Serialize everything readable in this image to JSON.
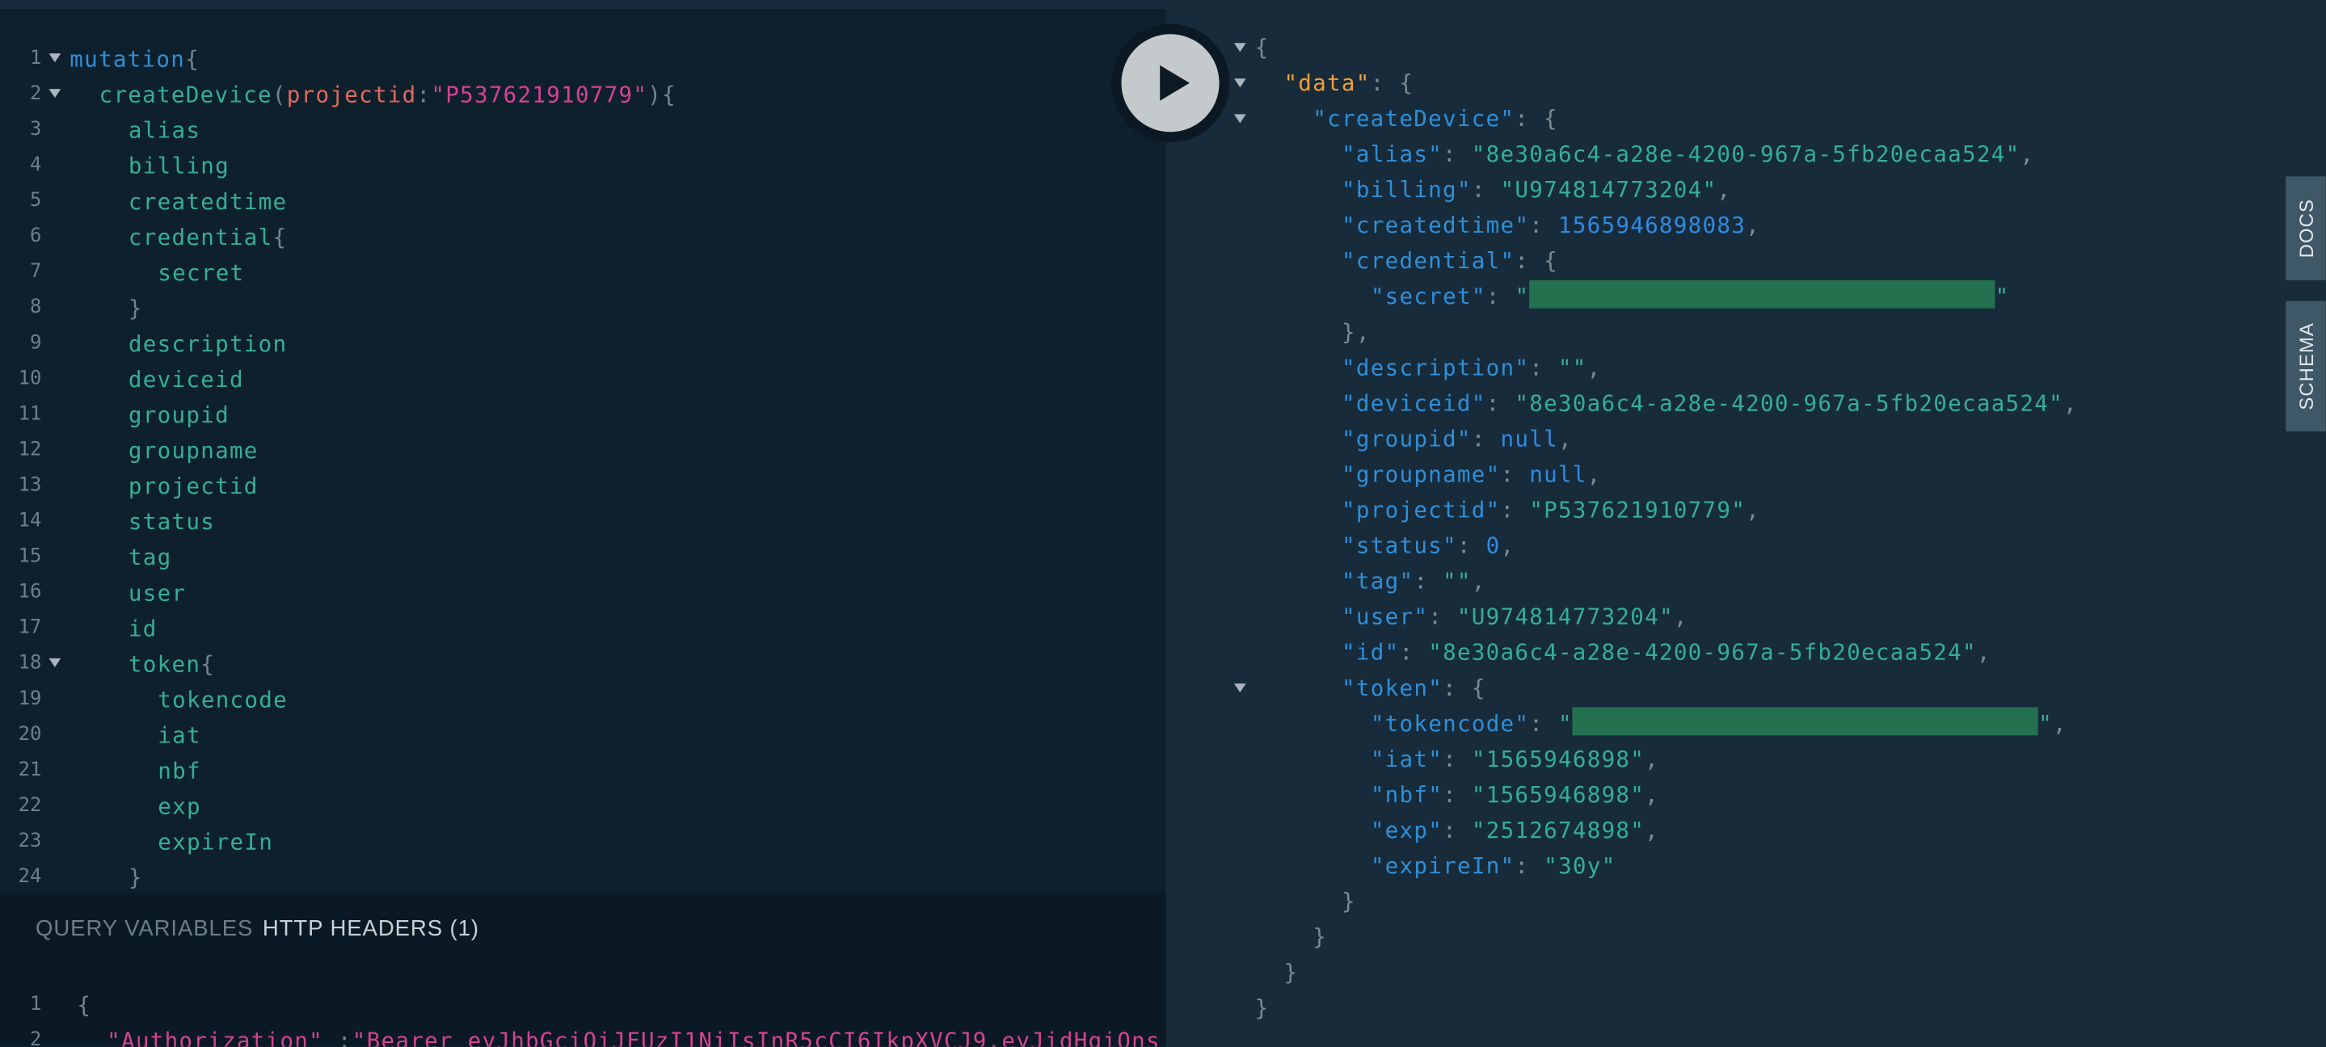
{
  "editor": {
    "lines": [
      {
        "n": "1",
        "fold": true,
        "ind": 0,
        "parts": [
          [
            "kw",
            "mutation"
          ],
          [
            "pn",
            "{"
          ]
        ]
      },
      {
        "n": "2",
        "fold": true,
        "ind": 1,
        "parts": [
          [
            "fn",
            "createDevice"
          ],
          [
            "pn",
            "("
          ],
          [
            "ar",
            "projectid"
          ],
          [
            "pn",
            ":"
          ],
          [
            "st",
            "\"P537621910779\""
          ],
          [
            "pn",
            "){"
          ]
        ]
      },
      {
        "n": "3",
        "ind": 2,
        "parts": [
          [
            "fd",
            "alias"
          ]
        ]
      },
      {
        "n": "4",
        "ind": 2,
        "parts": [
          [
            "fd",
            "billing"
          ]
        ]
      },
      {
        "n": "5",
        "ind": 2,
        "parts": [
          [
            "fd",
            "createdtime"
          ]
        ]
      },
      {
        "n": "6",
        "ind": 2,
        "parts": [
          [
            "fd",
            "credential"
          ],
          [
            "pn",
            "{"
          ]
        ]
      },
      {
        "n": "7",
        "ind": 3,
        "parts": [
          [
            "fd",
            "secret"
          ]
        ]
      },
      {
        "n": "8",
        "ind": 2,
        "parts": [
          [
            "pn",
            "}"
          ]
        ]
      },
      {
        "n": "9",
        "ind": 2,
        "parts": [
          [
            "fd",
            "description"
          ]
        ]
      },
      {
        "n": "10",
        "ind": 2,
        "parts": [
          [
            "fd",
            "deviceid"
          ]
        ]
      },
      {
        "n": "11",
        "ind": 2,
        "parts": [
          [
            "fd",
            "groupid"
          ]
        ]
      },
      {
        "n": "12",
        "ind": 2,
        "parts": [
          [
            "fd",
            "groupname"
          ]
        ]
      },
      {
        "n": "13",
        "ind": 2,
        "parts": [
          [
            "fd",
            "projectid"
          ]
        ]
      },
      {
        "n": "14",
        "ind": 2,
        "parts": [
          [
            "fd",
            "status"
          ]
        ]
      },
      {
        "n": "15",
        "ind": 2,
        "parts": [
          [
            "fd",
            "tag"
          ]
        ]
      },
      {
        "n": "16",
        "ind": 2,
        "parts": [
          [
            "fd",
            "user"
          ]
        ]
      },
      {
        "n": "17",
        "ind": 2,
        "parts": [
          [
            "fd",
            "id"
          ]
        ]
      },
      {
        "n": "18",
        "fold": true,
        "ind": 2,
        "parts": [
          [
            "fd",
            "token"
          ],
          [
            "pn",
            "{"
          ]
        ]
      },
      {
        "n": "19",
        "ind": 3,
        "parts": [
          [
            "fd",
            "tokencode"
          ]
        ]
      },
      {
        "n": "20",
        "ind": 3,
        "parts": [
          [
            "fd",
            "iat"
          ]
        ]
      },
      {
        "n": "21",
        "ind": 3,
        "parts": [
          [
            "fd",
            "nbf"
          ]
        ]
      },
      {
        "n": "22",
        "ind": 3,
        "parts": [
          [
            "fd",
            "exp"
          ]
        ]
      },
      {
        "n": "23",
        "ind": 3,
        "parts": [
          [
            "fd",
            "expireIn"
          ]
        ]
      },
      {
        "n": "24",
        "ind": 2,
        "parts": [
          [
            "pn",
            "}"
          ]
        ]
      }
    ]
  },
  "variables_panel": {
    "tab_query_variables": "QUERY VARIABLES",
    "tab_http_headers": "HTTP HEADERS (1)",
    "lines": [
      {
        "n": "1",
        "ind": 0,
        "parts": [
          [
            "pn",
            "{"
          ]
        ]
      },
      {
        "n": "2",
        "ind": 1,
        "parts": [
          [
            "vstr",
            "\"Authorization\""
          ],
          [
            "pn",
            " :"
          ],
          [
            "vstr",
            "\"Bearer eyJhbGciOiJFUzI1NiIsInR5cCI6IkpXVCJ9.eyJidHgiOns"
          ]
        ]
      }
    ]
  },
  "result": {
    "lines": [
      {
        "fold": true,
        "ind": 0,
        "parts": [
          [
            "rp",
            "{"
          ]
        ]
      },
      {
        "fold": true,
        "ind": 1,
        "parts": [
          [
            "rk-top",
            "\"data\""
          ],
          [
            "rp",
            ": {"
          ]
        ]
      },
      {
        "fold": true,
        "ind": 2,
        "parts": [
          [
            "rk",
            "\"createDevice\""
          ],
          [
            "rp",
            ": {"
          ]
        ]
      },
      {
        "ind": 3,
        "parts": [
          [
            "rk",
            "\"alias\""
          ],
          [
            "rp",
            ": "
          ],
          [
            "rs",
            "\"8e30a6c4-a28e-4200-967a-5fb20ecaa524\""
          ],
          [
            "rp",
            ","
          ]
        ]
      },
      {
        "ind": 3,
        "parts": [
          [
            "rk",
            "\"billing\""
          ],
          [
            "rp",
            ": "
          ],
          [
            "rs",
            "\"U974814773204\""
          ],
          [
            "rp",
            ","
          ]
        ]
      },
      {
        "ind": 3,
        "parts": [
          [
            "rk",
            "\"createdtime\""
          ],
          [
            "rp",
            ": "
          ],
          [
            "rn",
            "1565946898083"
          ],
          [
            "rp",
            ","
          ]
        ]
      },
      {
        "ind": 3,
        "parts": [
          [
            "rk",
            "\"credential\""
          ],
          [
            "rp",
            ": {"
          ]
        ]
      },
      {
        "ind": 4,
        "parts": [
          [
            "rk",
            "\"secret\""
          ],
          [
            "rp",
            ": "
          ],
          [
            "rs",
            "\""
          ],
          [
            "redact",
            ""
          ],
          [
            "rs",
            "\""
          ]
        ]
      },
      {
        "ind": 3,
        "parts": [
          [
            "rp",
            "},"
          ]
        ]
      },
      {
        "ind": 3,
        "parts": [
          [
            "rk",
            "\"description\""
          ],
          [
            "rp",
            ": "
          ],
          [
            "rs",
            "\"\""
          ],
          [
            "rp",
            ","
          ]
        ]
      },
      {
        "ind": 3,
        "parts": [
          [
            "rk",
            "\"deviceid\""
          ],
          [
            "rp",
            ": "
          ],
          [
            "rs",
            "\"8e30a6c4-a28e-4200-967a-5fb20ecaa524\""
          ],
          [
            "rp",
            ","
          ]
        ]
      },
      {
        "ind": 3,
        "parts": [
          [
            "rk",
            "\"groupid\""
          ],
          [
            "rp",
            ": "
          ],
          [
            "rnull",
            "null"
          ],
          [
            "rp",
            ","
          ]
        ]
      },
      {
        "ind": 3,
        "parts": [
          [
            "rk",
            "\"groupname\""
          ],
          [
            "rp",
            ": "
          ],
          [
            "rnull",
            "null"
          ],
          [
            "rp",
            ","
          ]
        ]
      },
      {
        "ind": 3,
        "parts": [
          [
            "rk",
            "\"projectid\""
          ],
          [
            "rp",
            ": "
          ],
          [
            "rs",
            "\"P537621910779\""
          ],
          [
            "rp",
            ","
          ]
        ]
      },
      {
        "ind": 3,
        "parts": [
          [
            "rk",
            "\"status\""
          ],
          [
            "rp",
            ": "
          ],
          [
            "rn",
            "0"
          ],
          [
            "rp",
            ","
          ]
        ]
      },
      {
        "ind": 3,
        "parts": [
          [
            "rk",
            "\"tag\""
          ],
          [
            "rp",
            ": "
          ],
          [
            "rs",
            "\"\""
          ],
          [
            "rp",
            ","
          ]
        ]
      },
      {
        "ind": 3,
        "parts": [
          [
            "rk",
            "\"user\""
          ],
          [
            "rp",
            ": "
          ],
          [
            "rs",
            "\"U974814773204\""
          ],
          [
            "rp",
            ","
          ]
        ]
      },
      {
        "ind": 3,
        "parts": [
          [
            "rk",
            "\"id\""
          ],
          [
            "rp",
            ": "
          ],
          [
            "rs",
            "\"8e30a6c4-a28e-4200-967a-5fb20ecaa524\""
          ],
          [
            "rp",
            ","
          ]
        ]
      },
      {
        "fold": true,
        "ind": 3,
        "parts": [
          [
            "rk",
            "\"token\""
          ],
          [
            "rp",
            ": {"
          ]
        ]
      },
      {
        "ind": 4,
        "parts": [
          [
            "rk",
            "\"tokencode\""
          ],
          [
            "rp",
            ": "
          ],
          [
            "rs",
            "\""
          ],
          [
            "redact",
            ""
          ],
          [
            "rs",
            "\""
          ],
          [
            "rp",
            ","
          ]
        ]
      },
      {
        "ind": 4,
        "parts": [
          [
            "rk",
            "\"iat\""
          ],
          [
            "rp",
            ": "
          ],
          [
            "rs",
            "\"1565946898\""
          ],
          [
            "rp",
            ","
          ]
        ]
      },
      {
        "ind": 4,
        "parts": [
          [
            "rk",
            "\"nbf\""
          ],
          [
            "rp",
            ": "
          ],
          [
            "rs",
            "\"1565946898\""
          ],
          [
            "rp",
            ","
          ]
        ]
      },
      {
        "ind": 4,
        "parts": [
          [
            "rk",
            "\"exp\""
          ],
          [
            "rp",
            ": "
          ],
          [
            "rs",
            "\"2512674898\""
          ],
          [
            "rp",
            ","
          ]
        ]
      },
      {
        "ind": 4,
        "parts": [
          [
            "rk",
            "\"expireIn\""
          ],
          [
            "rp",
            ": "
          ],
          [
            "rs",
            "\"30y\""
          ]
        ]
      },
      {
        "ind": 3,
        "parts": [
          [
            "rp",
            "}"
          ]
        ]
      },
      {
        "ind": 2,
        "parts": [
          [
            "rp",
            "}"
          ]
        ]
      },
      {
        "ind": 1,
        "parts": [
          [
            "rp",
            "}"
          ]
        ]
      },
      {
        "ind": 0,
        "parts": [
          [
            "rp",
            "}"
          ]
        ]
      }
    ]
  },
  "run_button": {
    "icon": "play-icon"
  },
  "side_tabs": {
    "docs": "DOCS",
    "schema": "SCHEMA"
  },
  "colors": {
    "editor_bg": "#0f202d",
    "result_bg": "#172b3a",
    "keyword": "#2e8fd9",
    "field": "#34ae97",
    "string": "#d64292",
    "arg": "#e06b5c",
    "data_key": "#f29d39",
    "redaction": "#23714f"
  }
}
